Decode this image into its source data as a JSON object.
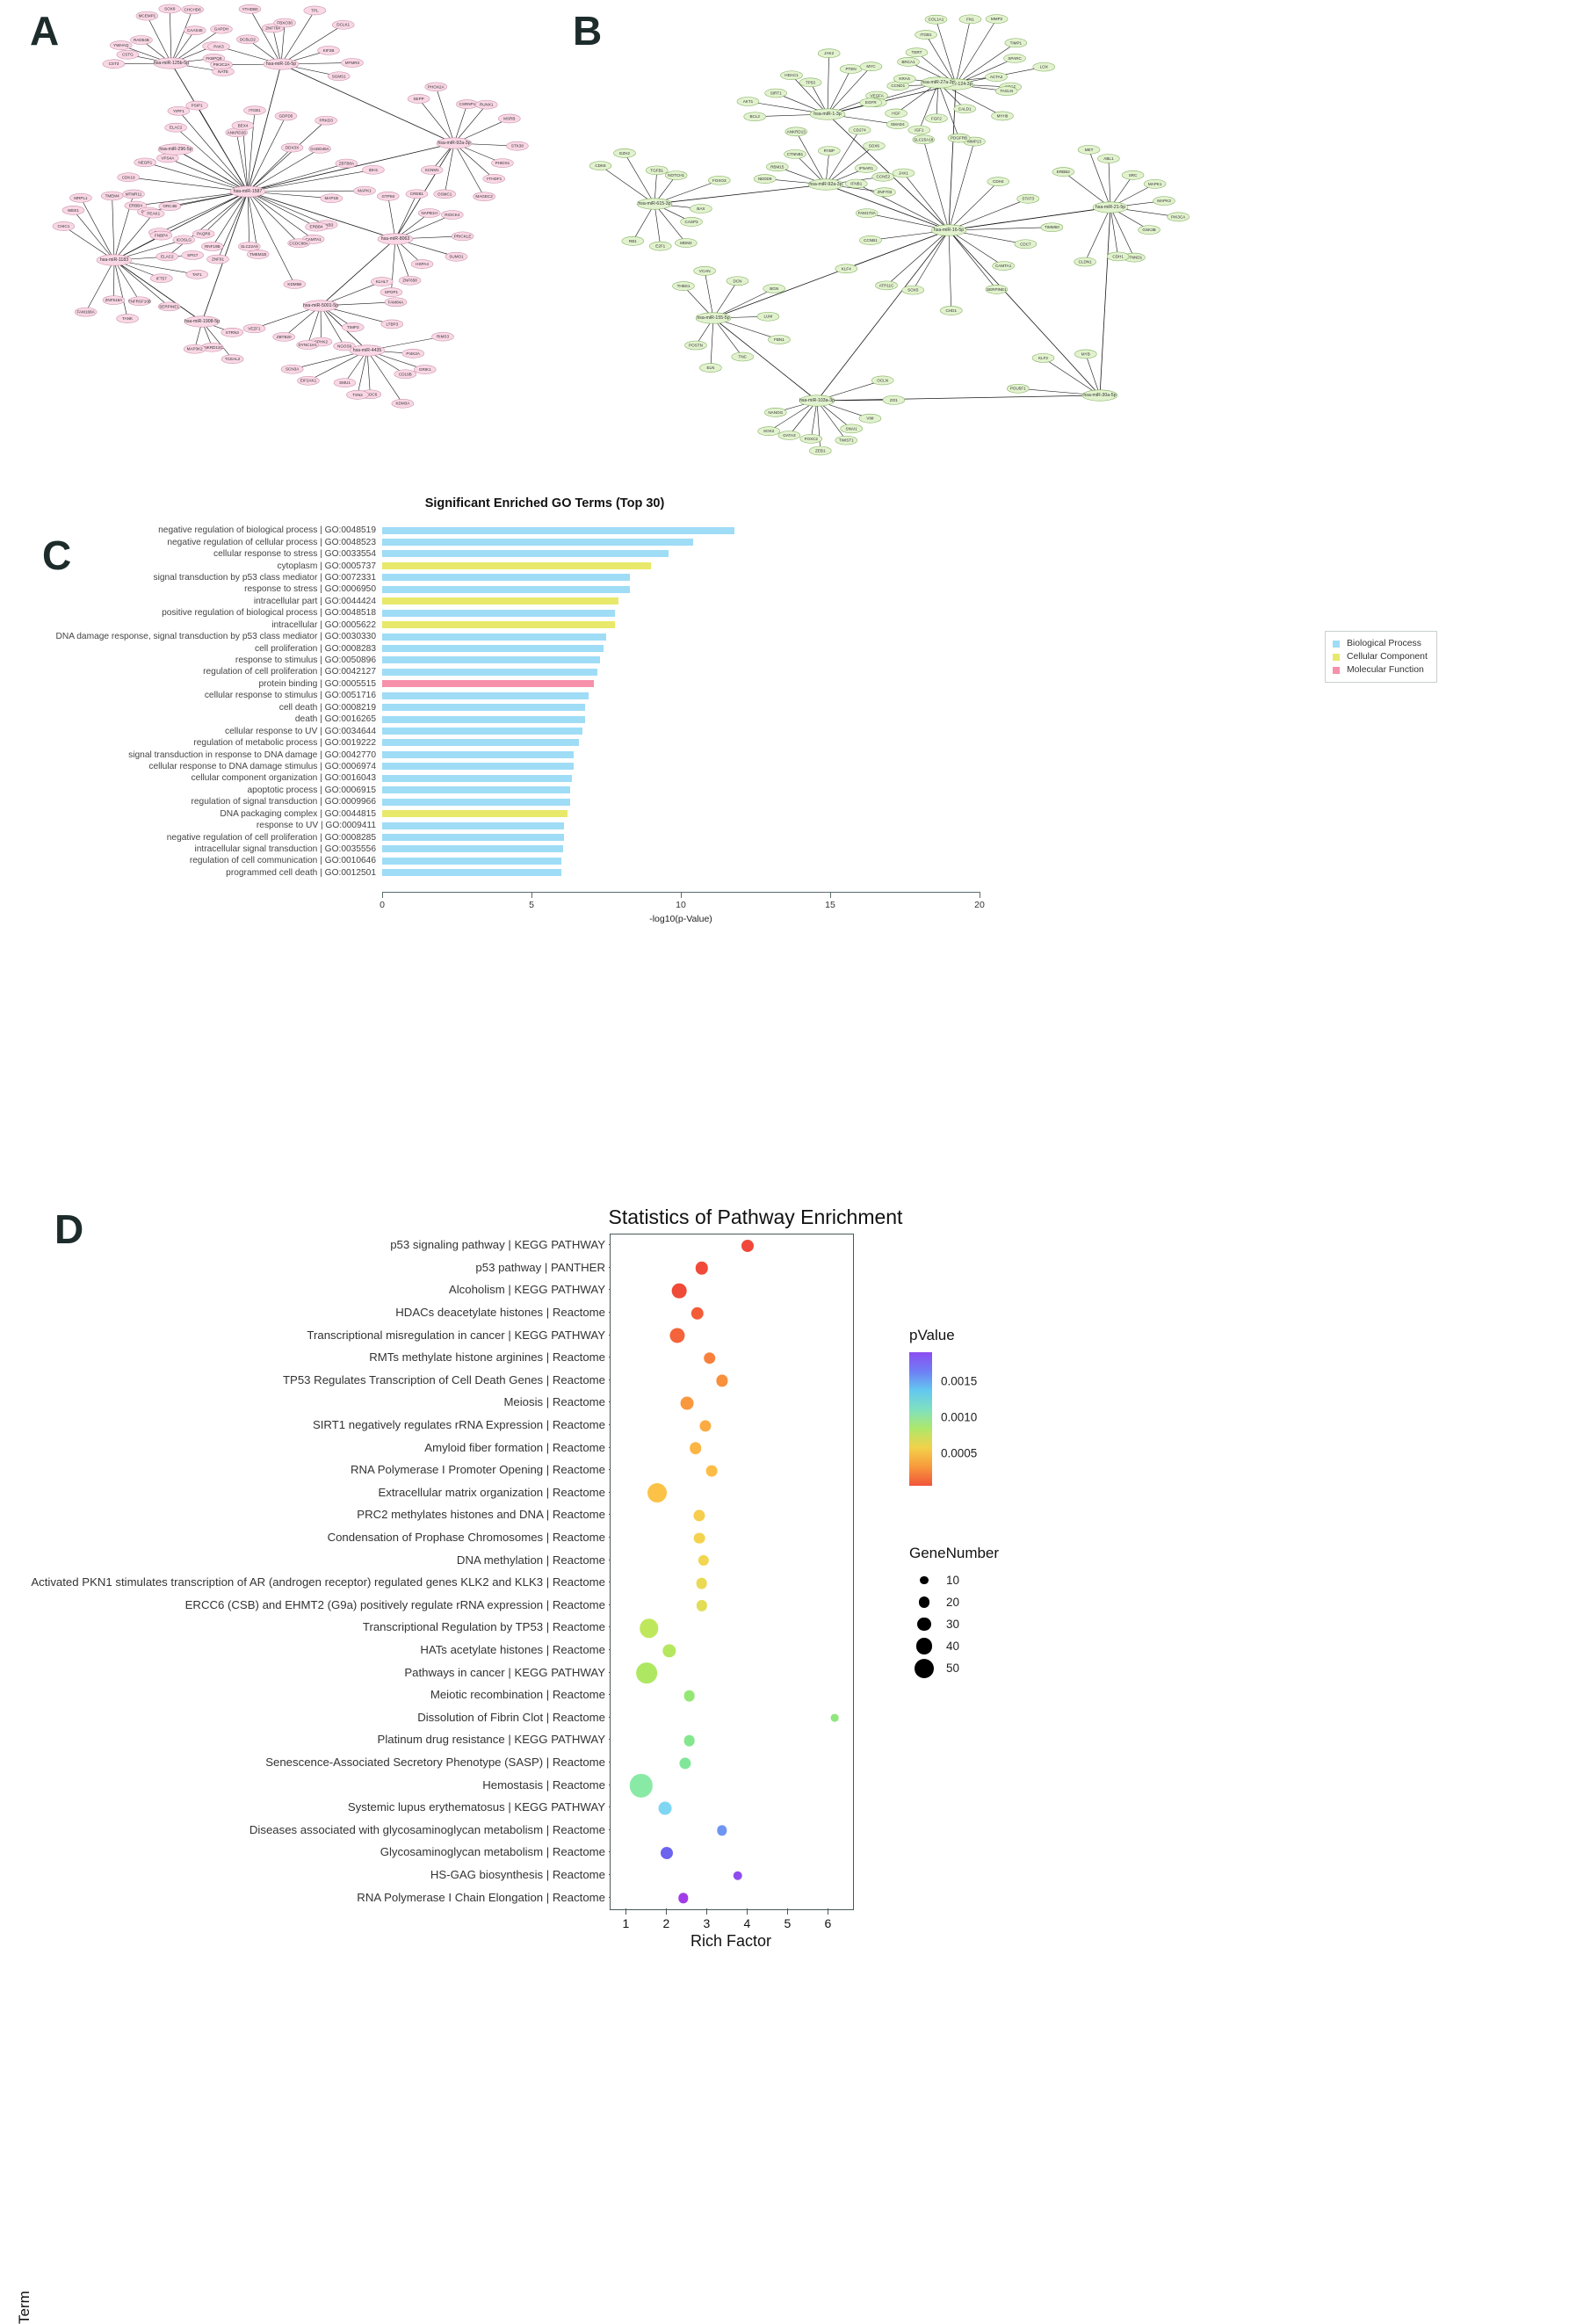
{
  "panels": {
    "a_letter": "A",
    "b_letter": "B",
    "c_letter": "C",
    "d_letter": "D"
  },
  "network_a": {
    "node_fill": "#f9d7e4",
    "node_stroke": "#c98fa8",
    "edge_color": "#1a1a1a",
    "hubs": [
      "hsa-miR-125b-5p",
      "hsa-miR-16-5p",
      "hsa-miR-1587",
      "hsa-miR-1183",
      "hsa-miR-92a-3p",
      "hsa-miR-8063",
      "hsa-miR-5001-5p",
      "hsa-miR-4435",
      "hsa-miR-1908-5p",
      "hsa-miR-296-5p"
    ],
    "genes": [
      "CST3",
      "CSTG",
      "YWHAQ",
      "RAD54B",
      "MCEMP1",
      "SOX8",
      "CHCHD6",
      "CAAS45",
      "GAPDH",
      "MPP2",
      "FKBPQ9",
      "NATE",
      "PIK3C2A",
      "PAK3",
      "DCBLD2",
      "YTHDB0",
      "ZNF764",
      "FBXO30",
      "TPL",
      "DCLK1",
      "KIF2B",
      "MTMR3",
      "SGMS1",
      "ORC4B",
      "ERBB4",
      "CDK19",
      "NEGR1",
      "VPS4A",
      "ELAC2",
      "YIPF1",
      "PSIP1",
      "ANKRD28",
      "BEX4",
      "ITGB1",
      "GDPD5",
      "DDX3X",
      "PRKD3",
      "GADD45A",
      "ZBTB8A",
      "IDH1",
      "MAPK1",
      "MAP1B",
      "HOXB3",
      "ERBB4",
      "CAMTA1",
      "CCDC88A",
      "KDM5B",
      "TMEM1B",
      "SLC22A9",
      "ZNF91",
      "RNF19B",
      "PAQR6",
      "ELAC2",
      "COBP",
      "PGAM1",
      "CHIC1",
      "WEE1",
      "MRPL1",
      "TMEM4",
      "MTMR11",
      "PEAK1",
      "FNBP4",
      "ICOSLG",
      "SPG7",
      "TAF1",
      "IFT57",
      "SERPINE1",
      "TNFRSF10B",
      "TANK",
      "ZNF518A",
      "FAM168A",
      "SEPP",
      "PHOX2A",
      "CSRNP1",
      "RUNX1",
      "MSRB",
      "STK38",
      "PHIDS1",
      "YTHDF1",
      "MAGEC2",
      "OSMC1",
      "SCNM1",
      "GTPIM",
      "CREB1",
      "NAPB1H",
      "RIOCK4",
      "PRICKLE",
      "SUMO1",
      "HSPA4",
      "ZNF658",
      "SPOP1",
      "KLHL7",
      "FAM84A",
      "LTBP3",
      "TIMP3",
      "NGOS9",
      "SPHK2",
      "DYNC1H1",
      "ZBTB20",
      "VEZF1",
      "RIMS3",
      "PI4K2A",
      "GRIK1",
      "CD19B",
      "KDM3A",
      "CCDC6",
      "TXN2",
      "SMU1",
      "EIF2AK1",
      "SCN3A",
      "STRN3",
      "TCEAL2",
      "ANKRD13C",
      "MAP3K2"
    ]
  },
  "network_b": {
    "node_fill": "#e2f2cf",
    "node_stroke": "#7fae5a",
    "edge_color": "#1a1a1a",
    "hubs": [
      "hsa-miR-16-5p",
      "hsa-miR-92a-3p",
      "hsa-miR-1-3p",
      "hsa-miR-615-3p",
      "hsa-miR-124-3p",
      "hsa-miR-155-5p",
      "hsa-miR-27a-3p",
      "hsa-miR-21-5p",
      "hsa-miR-103a-3p",
      "hsa-miR-30a-5p"
    ],
    "genes": [
      "CCNB1",
      "FAM170A",
      "IFNB1",
      "JAK1",
      "SLC25A18",
      "MMP13",
      "CDH4",
      "STAT3",
      "TIMM50",
      "CDC7",
      "CAMTA1",
      "SERPINE1",
      "CHD1",
      "SOX5",
      "ATP11C",
      "KLF4",
      "NEDD9",
      "RBM15",
      "CTNNB1",
      "ANKRD13",
      "RYBP",
      "CD274",
      "SOX6",
      "IFNAR1",
      "CCNE2",
      "ZNF703",
      "BCL2",
      "AKT1",
      "SIRT1",
      "HDAC1",
      "TP53",
      "JAK2",
      "PTEN",
      "MYC",
      "VEGFA",
      "RHOA",
      "SMAD4",
      "CDK6",
      "EZH2",
      "TGFB1",
      "NOTCH1",
      "FOXO3",
      "BAX",
      "CASP3",
      "MDM2",
      "E2F1",
      "RB1",
      "CCND1",
      "KRAS",
      "BRCA1",
      "TERT",
      "ITGB1",
      "COL1A1",
      "FN1",
      "MMP2",
      "TIMP1",
      "SPARC",
      "LOX",
      "CTGF",
      "THBS1",
      "VCAN",
      "DCN",
      "BGN",
      "LUM",
      "FBN1",
      "TNC",
      "ELN",
      "POSTN",
      "ACTA2",
      "TAGLN",
      "MYH9",
      "CALD1",
      "PDGFRB",
      "FGF2",
      "IGF1",
      "HGF",
      "EGFR",
      "ERBB2",
      "MET",
      "ABL1",
      "SRC",
      "MAPK1",
      "MAPK3",
      "PIK3CA",
      "GSK3B",
      "CTNND1",
      "CDH1",
      "CLDN1",
      "OCLN",
      "ZO1",
      "VIM",
      "SNAI1",
      "TWIST1",
      "ZEB1",
      "FOXC2",
      "GATA3",
      "SOX2",
      "NANOG",
      "POU5F1",
      "KLF2",
      "MYB"
    ]
  },
  "panel_c": {
    "title": "Significant Enriched GO Terms (Top 30)",
    "xlabel": "-log10(p-Value)",
    "xticks": [
      0,
      5,
      10,
      15,
      20
    ],
    "xmax": 20,
    "legend": [
      {
        "label": "Biological Process",
        "color": "#9fdcf6"
      },
      {
        "label": "Cellular Component",
        "color": "#e8e96a"
      },
      {
        "label": "Molecular Function",
        "color": "#f790ab"
      }
    ],
    "chart_data": {
      "type": "bar",
      "title": "Significant Enriched GO Terms (Top 30)",
      "xlabel": "-log10(p-Value)",
      "ylabel": "",
      "xlim": [
        0,
        20
      ],
      "grid": false,
      "legend_position": "right",
      "orientation": "horizontal",
      "categories": [
        "negative regulation of biological process | GO:0048519",
        "negative regulation of cellular process | GO:0048523",
        "cellular response to stress | GO:0033554",
        "cytoplasm | GO:0005737",
        "signal transduction by p53 class mediator | GO:0072331",
        "response to stress | GO:0006950",
        "intracellular part | GO:0044424",
        "positive regulation of biological process | GO:0048518",
        "intracellular | GO:0005622",
        "DNA damage response, signal transduction by p53 class mediator | GO:0030330",
        "cell proliferation | GO:0008283",
        "response to stimulus | GO:0050896",
        "regulation of cell proliferation | GO:0042127",
        "protein binding | GO:0005515",
        "cellular response to stimulus | GO:0051716",
        "cell death | GO:0008219",
        "death | GO:0016265",
        "cellular response to UV | GO:0034644",
        "regulation of metabolic process | GO:0019222",
        "signal transduction in response to DNA damage | GO:0042770",
        "cellular response to DNA damage stimulus | GO:0006974",
        "cellular component organization | GO:0016043",
        "apoptotic process | GO:0006915",
        "regulation of signal transduction | GO:0009966",
        "DNA packaging complex | GO:0044815",
        "response to UV | GO:0009411",
        "negative regulation of cell proliferation | GO:0008285",
        "intracellular signal transduction | GO:0035556",
        "regulation of cell communication | GO:0010646",
        "programmed cell death | GO:0012501"
      ],
      "values": [
        11.8,
        10.4,
        9.6,
        9.0,
        8.3,
        8.3,
        7.9,
        7.8,
        7.8,
        7.5,
        7.4,
        7.3,
        7.2,
        7.1,
        6.9,
        6.8,
        6.8,
        6.7,
        6.6,
        6.4,
        6.4,
        6.35,
        6.3,
        6.3,
        6.2,
        6.1,
        6.1,
        6.05,
        6.0,
        6.0
      ],
      "classes": [
        "Biological Process",
        "Biological Process",
        "Biological Process",
        "Cellular Component",
        "Biological Process",
        "Biological Process",
        "Cellular Component",
        "Biological Process",
        "Cellular Component",
        "Biological Process",
        "Biological Process",
        "Biological Process",
        "Biological Process",
        "Molecular Function",
        "Biological Process",
        "Biological Process",
        "Biological Process",
        "Biological Process",
        "Biological Process",
        "Biological Process",
        "Biological Process",
        "Biological Process",
        "Biological Process",
        "Biological Process",
        "Cellular Component",
        "Biological Process",
        "Biological Process",
        "Biological Process",
        "Biological Process",
        "Biological Process"
      ]
    }
  },
  "panel_d": {
    "title": "Statistics of Pathway Enrichment",
    "xlabel": "Rich Factor",
    "ylabel": "Term",
    "xticks": [
      1,
      2,
      3,
      4,
      5,
      6
    ],
    "xlim": [
      0.6,
      6.6
    ],
    "color_legend": {
      "title": "pValue",
      "ticks": [
        0.0015,
        0.001,
        0.0005
      ],
      "stops": [
        "#8c4df0",
        "#6f7ef5",
        "#63c8f0",
        "#7fe0c0",
        "#aee86a",
        "#f2d14a",
        "#f79a3c",
        "#f0543a"
      ]
    },
    "size_legend": {
      "title": "GeneNumber",
      "values": [
        10,
        20,
        30,
        40,
        50
      ]
    },
    "chart_data": {
      "type": "scatter",
      "title": "Statistics of Pathway Enrichment",
      "xlabel": "Rich Factor",
      "ylabel": "Term",
      "xlim": [
        0.6,
        6.6
      ],
      "grid": false,
      "color_by": "pValue",
      "size_by": "GeneNumber",
      "points": [
        {
          "term": "p53 signaling pathway | KEGG PATHWAY",
          "rich_factor": 4.0,
          "pValue": 5e-05,
          "geneNumber": 16,
          "color": "#f0473a"
        },
        {
          "term": "p53 pathway | PANTHER",
          "rich_factor": 2.85,
          "pValue": 6e-05,
          "geneNumber": 17,
          "color": "#f24a3a"
        },
        {
          "term": "Alcoholism | KEGG PATHWAY",
          "rich_factor": 2.3,
          "pValue": 6e-05,
          "geneNumber": 22,
          "color": "#f04a38"
        },
        {
          "term": "HDACs deacetylate histones | Reactome",
          "rich_factor": 2.75,
          "pValue": 8e-05,
          "geneNumber": 17,
          "color": "#f45c38"
        },
        {
          "term": "Transcriptional misregulation in cancer | KEGG PATHWAY",
          "rich_factor": 2.25,
          "pValue": 9e-05,
          "geneNumber": 23,
          "color": "#f4633a"
        },
        {
          "term": "RMTs methylate histone arginines | Reactome",
          "rich_factor": 3.05,
          "pValue": 0.00012,
          "geneNumber": 15,
          "color": "#f7813c"
        },
        {
          "term": "TP53 Regulates Transcription of Cell Death Genes | Reactome",
          "rich_factor": 3.35,
          "pValue": 0.00014,
          "geneNumber": 14,
          "color": "#f8903d"
        },
        {
          "term": "Meiosis | Reactome",
          "rich_factor": 2.5,
          "pValue": 0.00015,
          "geneNumber": 18,
          "color": "#f9983e"
        },
        {
          "term": "SIRT1 negatively regulates rRNA Expression | Reactome",
          "rich_factor": 2.95,
          "pValue": 0.00018,
          "geneNumber": 14,
          "color": "#fbab42"
        },
        {
          "term": "Amyloid fiber formation | Reactome",
          "rich_factor": 2.7,
          "pValue": 0.0002,
          "geneNumber": 15,
          "color": "#fbb544"
        },
        {
          "term": "RNA Polymerase I Promoter Opening | Reactome",
          "rich_factor": 3.1,
          "pValue": 0.00022,
          "geneNumber": 13,
          "color": "#fcbd46"
        },
        {
          "term": "Extracellular matrix organization | Reactome",
          "rich_factor": 1.75,
          "pValue": 0.00023,
          "geneNumber": 34,
          "color": "#fcc247"
        },
        {
          "term": "PRC2 methylates histones and DNA | Reactome",
          "rich_factor": 2.8,
          "pValue": 0.00026,
          "geneNumber": 14,
          "color": "#f6cd4c"
        },
        {
          "term": "Condensation of Prophase Chromosomes | Reactome",
          "rich_factor": 2.8,
          "pValue": 0.00028,
          "geneNumber": 13,
          "color": "#f4d24e"
        },
        {
          "term": "DNA methylation | Reactome",
          "rich_factor": 2.9,
          "pValue": 0.00029,
          "geneNumber": 12,
          "color": "#f2d550"
        },
        {
          "term": "Activated PKN1 stimulates transcription of AR (androgen receptor) regulated genes KLK2 and KLK3 | Reactome",
          "rich_factor": 2.85,
          "pValue": 0.00032,
          "geneNumber": 13,
          "color": "#eada53"
        },
        {
          "term": "ERCC6 (CSB) and EHMT2 (G9a) positively regulate rRNA expression | Reactome",
          "rich_factor": 2.85,
          "pValue": 0.00034,
          "geneNumber": 12,
          "color": "#e3dd56"
        },
        {
          "term": "Transcriptional Regulation by TP53 | Reactome",
          "rich_factor": 1.55,
          "pValue": 0.00038,
          "geneNumber": 33,
          "color": "#bfe75c"
        },
        {
          "term": "HATs acetylate histones | Reactome",
          "rich_factor": 2.05,
          "pValue": 0.0004,
          "geneNumber": 19,
          "color": "#b5e75f"
        },
        {
          "term": "Pathways in cancer | KEGG PATHWAY",
          "rich_factor": 1.5,
          "pValue": 0.00043,
          "geneNumber": 38,
          "color": "#aee862"
        },
        {
          "term": "Meiotic recombination | Reactome",
          "rich_factor": 2.55,
          "pValue": 0.00047,
          "geneNumber": 13,
          "color": "#95e775"
        },
        {
          "term": "Dissolution of Fibrin Clot | Reactome",
          "rich_factor": 6.15,
          "pValue": 0.00048,
          "geneNumber": 4,
          "color": "#8ee67d"
        },
        {
          "term": "Platinum drug resistance | KEGG PATHWAY",
          "rich_factor": 2.55,
          "pValue": 0.00055,
          "geneNumber": 13,
          "color": "#85e78d"
        },
        {
          "term": "Senescence-Associated Secretory Phenotype (SASP) | Reactome",
          "rich_factor": 2.45,
          "pValue": 0.00062,
          "geneNumber": 14,
          "color": "#80e79a"
        },
        {
          "term": "Hemostasis | Reactome",
          "rich_factor": 1.35,
          "pValue": 0.00072,
          "geneNumber": 44,
          "color": "#89eaa6"
        },
        {
          "term": "Systemic lupus erythematosus | KEGG PATHWAY",
          "rich_factor": 1.95,
          "pValue": 0.001,
          "geneNumber": 18,
          "color": "#7fd6f2"
        },
        {
          "term": "Diseases associated with glycosaminoglycan metabolism | Reactome",
          "rich_factor": 3.35,
          "pValue": 0.00128,
          "geneNumber": 10,
          "color": "#6f95f2"
        },
        {
          "term": "Glycosaminoglycan metabolism | Reactome",
          "rich_factor": 2.0,
          "pValue": 0.00152,
          "geneNumber": 16,
          "color": "#6c63ef"
        },
        {
          "term": "HS-GAG biosynthesis | Reactome",
          "rich_factor": 3.75,
          "pValue": 0.00172,
          "geneNumber": 8,
          "color": "#8e4bef"
        },
        {
          "term": "RNA Polymerase I Chain Elongation | Reactome",
          "rich_factor": 2.4,
          "pValue": 0.0019,
          "geneNumber": 10,
          "color": "#a23ce8"
        }
      ]
    }
  }
}
